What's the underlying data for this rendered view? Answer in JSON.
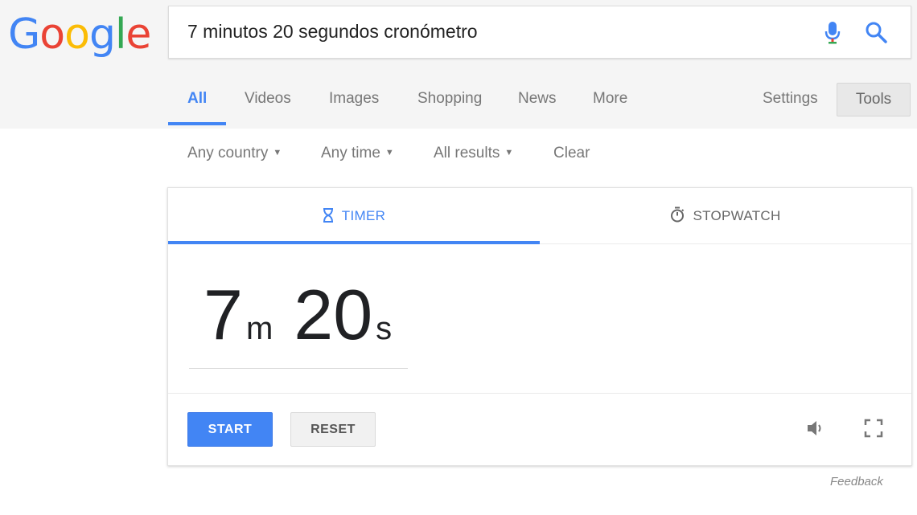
{
  "logo": {
    "letters": [
      {
        "char": "G",
        "color": "#4285f4"
      },
      {
        "char": "o",
        "color": "#ea4335"
      },
      {
        "char": "o",
        "color": "#fbbc05"
      },
      {
        "char": "g",
        "color": "#4285f4"
      },
      {
        "char": "l",
        "color": "#34a853"
      },
      {
        "char": "e",
        "color": "#ea4335"
      }
    ]
  },
  "search": {
    "query": "7 minutos 20 segundos cronómetro",
    "mic_icon": "mic-icon",
    "search_icon": "search-icon"
  },
  "nav": {
    "tabs": [
      {
        "label": "All",
        "active": true
      },
      {
        "label": "Videos"
      },
      {
        "label": "Images"
      },
      {
        "label": "Shopping"
      },
      {
        "label": "News"
      },
      {
        "label": "More"
      }
    ],
    "settings_label": "Settings",
    "tools_label": "Tools"
  },
  "filters": {
    "country": "Any country",
    "time": "Any time",
    "results": "All results",
    "clear": "Clear"
  },
  "timer_card": {
    "tabs": {
      "timer": "TIMER",
      "stopwatch": "STOPWATCH"
    },
    "active_tab": "timer",
    "minutes": "7",
    "minutes_unit": "m",
    "seconds": "20",
    "seconds_unit": "s",
    "start_label": "START",
    "reset_label": "RESET",
    "volume_icon": "volume-icon",
    "fullscreen_icon": "fullscreen-icon"
  },
  "feedback_label": "Feedback",
  "colors": {
    "accent": "#4285f4",
    "mic_red": "#ea4335",
    "header_bg": "#f5f5f5"
  }
}
